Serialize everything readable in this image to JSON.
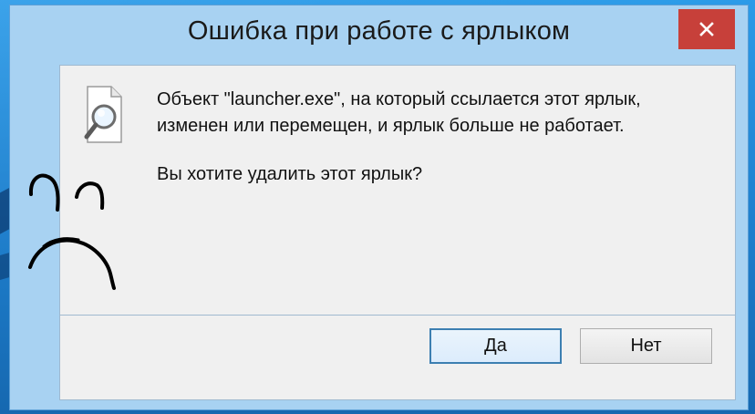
{
  "dialog": {
    "title": "Ошибка при работе с ярлыком",
    "message_line1": "Объект \"launcher.exe\", на который ссылается этот ярлык,",
    "message_line2": "изменен или перемещен, и ярлык больше не работает.",
    "question": "Вы хотите удалить этот ярлык?",
    "buttons": {
      "yes": "Да",
      "no": "Нет"
    },
    "icons": {
      "file": "file-search-icon",
      "close": "close-icon"
    },
    "colors": {
      "close_button": "#c7403a",
      "frame": "#a8d2f2",
      "desktop": "#1f86d6"
    }
  },
  "annotation": {
    "icon": "sad-face-drawing"
  }
}
